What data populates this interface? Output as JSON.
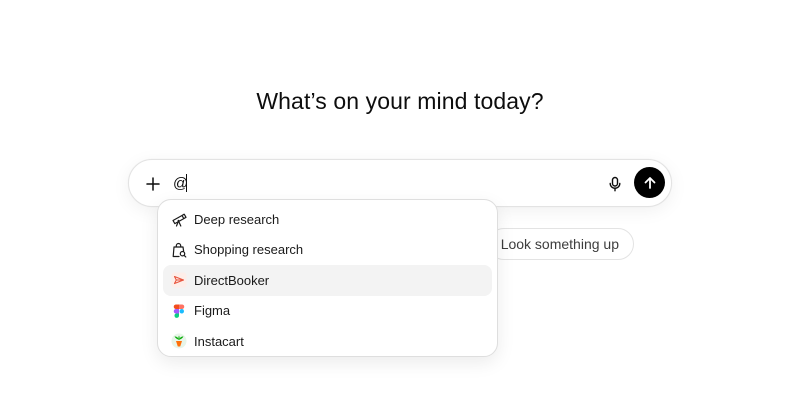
{
  "headline": "What’s on your mind today?",
  "composer": {
    "input_value": "@",
    "plus_icon": "plus-icon",
    "mic_icon": "microphone-icon",
    "send_icon": "arrow-up-icon"
  },
  "suggestion_chip": {
    "label": "Look something up"
  },
  "mention_menu": {
    "items": [
      {
        "label": "Deep research",
        "icon": "telescope-icon"
      },
      {
        "label": "Shopping research",
        "icon": "shopping-bag-search-icon"
      },
      {
        "label": "DirectBooker",
        "icon": "directbooker-icon",
        "highlighted": true
      },
      {
        "label": "Figma",
        "icon": "figma-icon"
      },
      {
        "label": "Instacart",
        "icon": "instacart-icon"
      }
    ]
  },
  "colors": {
    "send_button": "#000000",
    "highlight_row": "#f3f3f3",
    "directbooker_accent": "#e8553e"
  }
}
